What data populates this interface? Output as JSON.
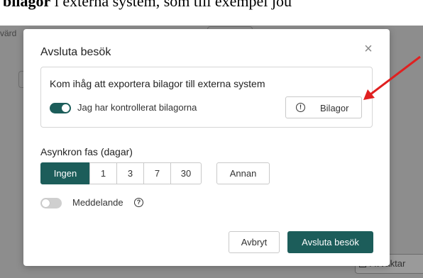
{
  "document": {
    "header_bold": "bilagor",
    "header_rest": " i externa system, som till exempel jou"
  },
  "background": {
    "tab_text": "värd",
    "button_text": "Avvaktar"
  },
  "modal": {
    "title": "Avsluta besök",
    "close_icon": "×",
    "notice": {
      "title": "Kom ihåg att exportera bilagor till externa system",
      "toggle_label": "Jag har kontrollerat bilagorna",
      "toggle_on": true,
      "button_label": "Bilagor",
      "button_icon": "!"
    },
    "async": {
      "label": "Asynkron fas (dagar)",
      "options": [
        "Ingen",
        "1",
        "3",
        "7",
        "30"
      ],
      "selected": "Ingen",
      "other_label": "Annan"
    },
    "message": {
      "label": "Meddelande",
      "help_icon": "?",
      "toggle_on": false
    },
    "footer": {
      "cancel_label": "Avbryt",
      "confirm_label": "Avsluta besök"
    }
  },
  "colors": {
    "accent": "#1c5d5a",
    "arrow": "#e02020",
    "overlay": "#8d8d8d"
  }
}
